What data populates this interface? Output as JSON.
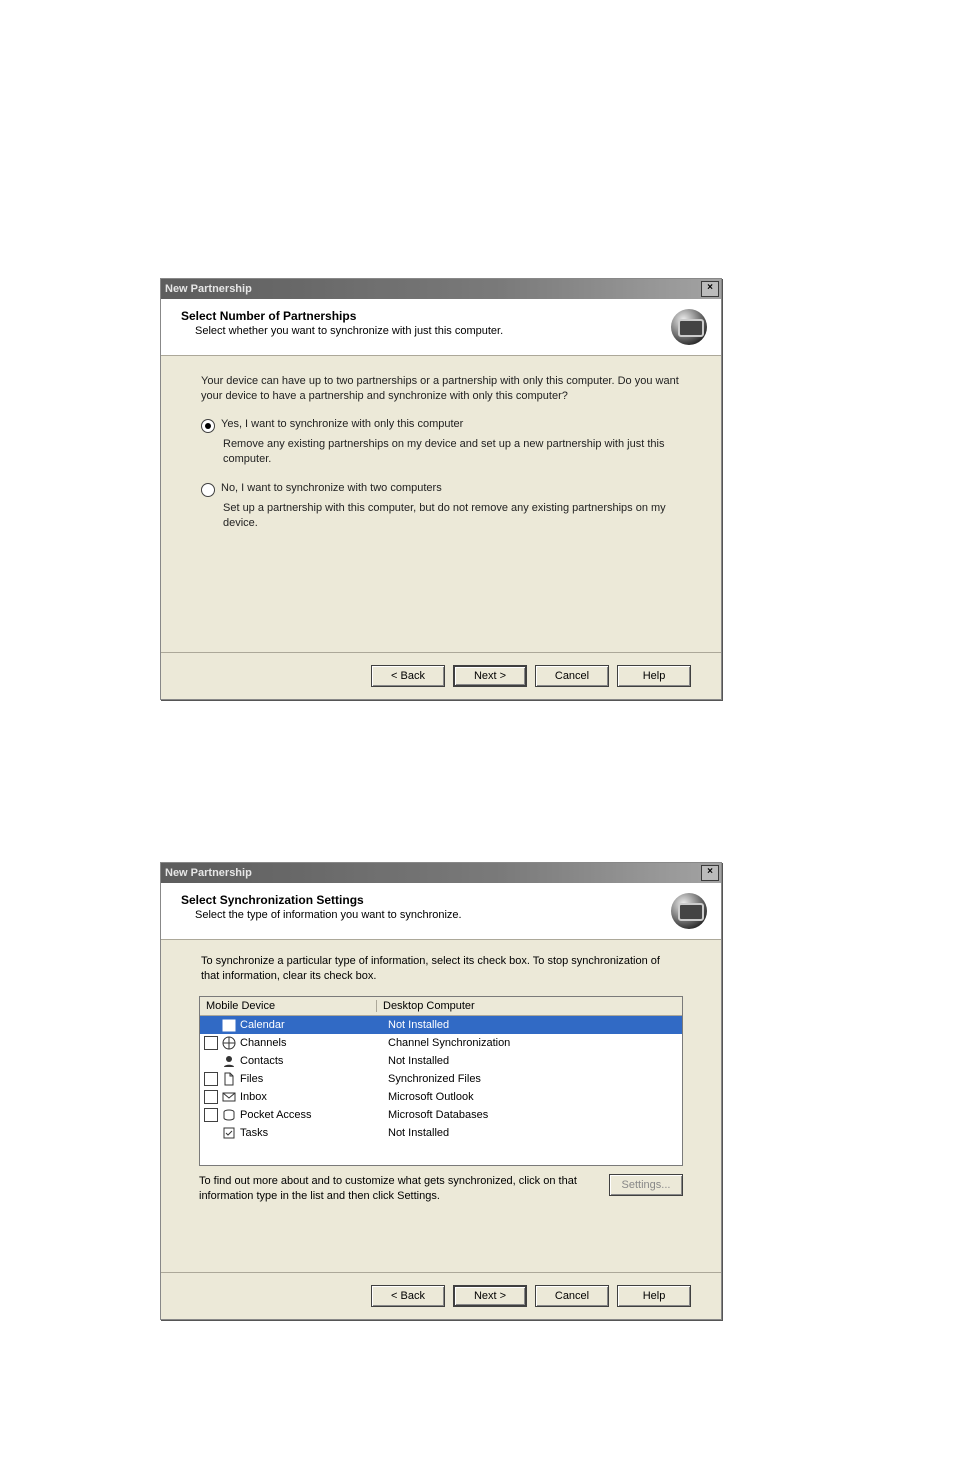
{
  "dialog1": {
    "title": "New Partnership",
    "header_title": "Select Number of Partnerships",
    "header_sub": "Select whether you want to synchronize with just this computer.",
    "intro": "Your device can have up to two partnerships or a partnership with only this computer. Do you want your device to have a partnership and synchronize with only this computer?",
    "opt1_label": "Yes, I want to synchronize with only this computer",
    "opt1_desc": "Remove any existing partnerships on my device and set up a new partnership with just this computer.",
    "opt2_label": "No, I want to synchronize with two computers",
    "opt2_desc": "Set up a partnership with this computer, but do not remove any existing partnerships on my device.",
    "buttons": {
      "back": "< Back",
      "next": "Next >",
      "cancel": "Cancel",
      "help": "Help"
    }
  },
  "dialog2": {
    "title": "New Partnership",
    "header_title": "Select Synchronization Settings",
    "header_sub": "Select the type of information you want to synchronize.",
    "instr": "To synchronize a particular type of information, select its check box. To stop synchronization of that information, clear its check box.",
    "col1": "Mobile Device",
    "col2": "Desktop Computer",
    "rows": [
      {
        "checkbox": false,
        "selected": true,
        "name": "Calendar",
        "desktop": "Not Installed"
      },
      {
        "checkbox": true,
        "selected": false,
        "name": "Channels",
        "desktop": "Channel Synchronization"
      },
      {
        "checkbox": false,
        "selected": false,
        "name": "Contacts",
        "desktop": "Not Installed"
      },
      {
        "checkbox": true,
        "selected": false,
        "name": "Files",
        "desktop": "Synchronized Files"
      },
      {
        "checkbox": true,
        "selected": false,
        "name": "Inbox",
        "desktop": "Microsoft Outlook"
      },
      {
        "checkbox": true,
        "selected": false,
        "name": "Pocket Access",
        "desktop": "Microsoft Databases"
      },
      {
        "checkbox": false,
        "selected": false,
        "name": "Tasks",
        "desktop": "Not Installed"
      }
    ],
    "footer": "To find out more about and to customize what gets synchronized, click on that information type in the list and then click Settings.",
    "settings_btn": "Settings...",
    "buttons": {
      "back": "< Back",
      "next": "Next >",
      "cancel": "Cancel",
      "help": "Help"
    }
  }
}
